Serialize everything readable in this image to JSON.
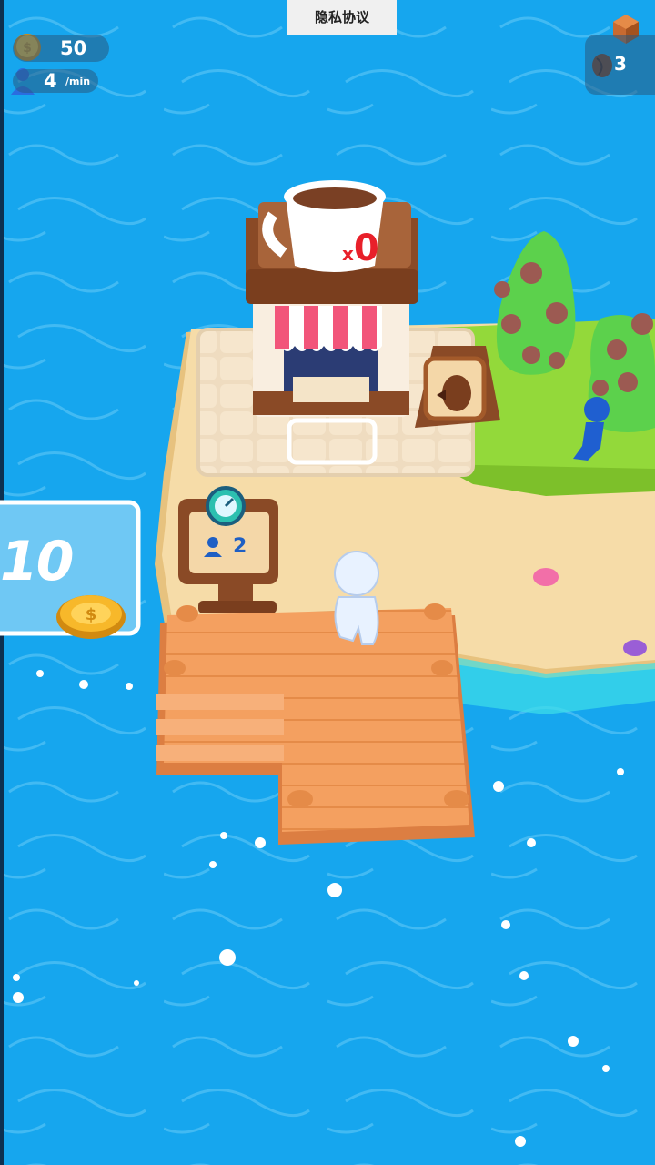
{
  "hud": {
    "coins": "50",
    "visitors_rate": "4",
    "visitors_rate_unit": "/min",
    "privacy_label": "隐私协议",
    "coffee_beans": "3"
  },
  "scene": {
    "cafe_cup_count_prefix": "x",
    "cafe_cup_count": "0",
    "queue_count": "2",
    "zone_label": "10"
  },
  "colors": {
    "sea": "#16a6ee",
    "sand": "#f6dca8",
    "grass": "#93d93a",
    "dock": "#f4a060",
    "awning_red": "#f2557a",
    "player": "#e8f2ff",
    "npc": "#1f5fd0"
  },
  "icons": [
    "coin-icon",
    "person-icon",
    "crate-icon",
    "coffee-bean-icon",
    "stopwatch-icon"
  ]
}
